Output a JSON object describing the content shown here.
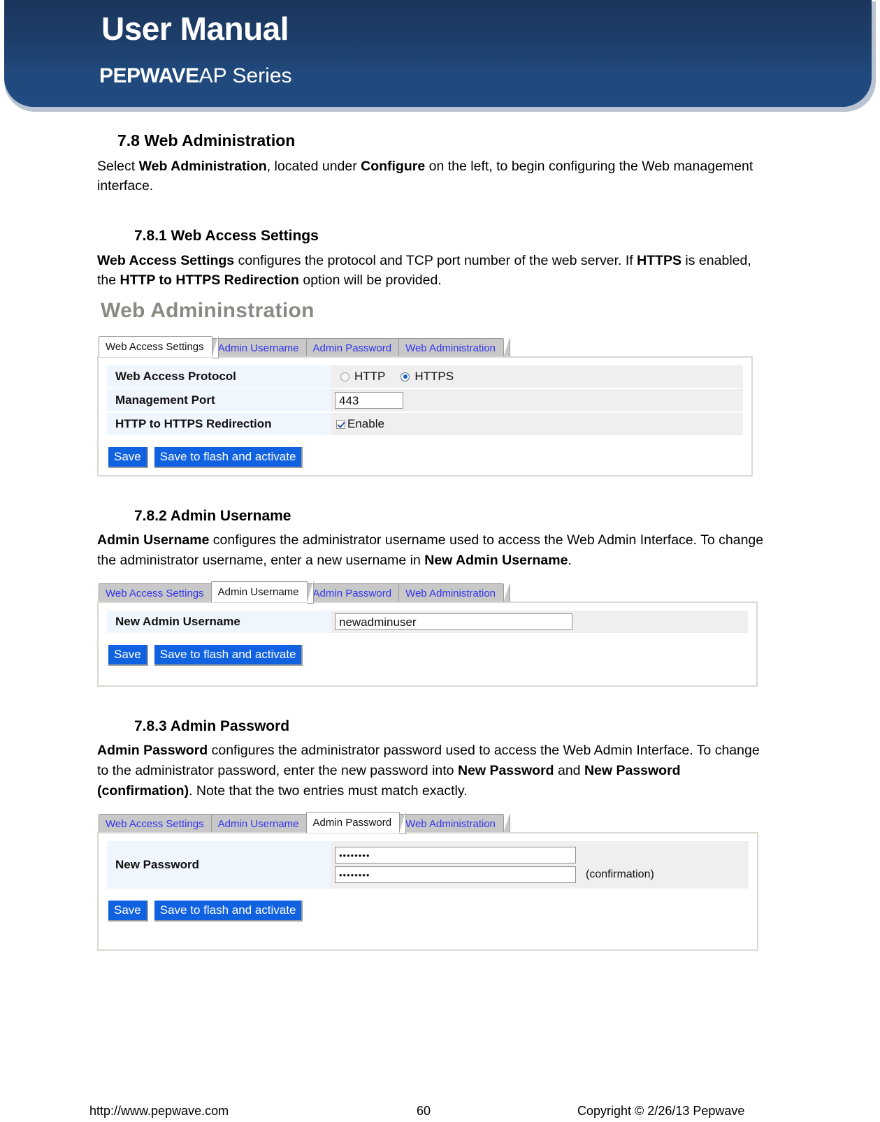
{
  "banner": {
    "title": "User Manual",
    "brand": "PEPWAVE",
    "series": "AP Series",
    "bg_color_top": "#1b365d",
    "bg_color_bottom": "#1f4b80"
  },
  "sections": {
    "s78": {
      "heading": "7.8 Web Administration",
      "para_1": "Select ",
      "para_1_b1": "Web Administration",
      "para_1_mid": ", located under ",
      "para_1_b2": "Configure",
      "para_1_end": " on the left, to begin configuring the Web management interface."
    },
    "s781": {
      "heading": "7.8.1 Web Access Settings",
      "para_b1": "Web Access Settings",
      "para_mid1": " configures the protocol and TCP port number of the web server. If ",
      "para_b2": "HTTPS",
      "para_mid2": " is enabled, the ",
      "para_b3": "HTTP to HTTPS Redirection",
      "para_end": " option will be provided."
    },
    "s782": {
      "heading": "7.8.2 Admin Username",
      "para_b1": "Admin Username",
      "para_mid1": " configures the administrator username used to access the Web Admin Interface. To change the administrator username, enter a new username in ",
      "para_b2": "New Admin Username",
      "para_end": "."
    },
    "s783": {
      "heading": "7.8.3 Admin Password",
      "para_b1": "Admin Password",
      "para_mid1": " configures the administrator password used to access the Web Admin Interface. To change to the administrator password, enter the new password into ",
      "para_b2": "New Password",
      "para_mid2": " and ",
      "para_b3": "New Password (confirmation)",
      "para_end": ". Note that the two entries must match exactly."
    }
  },
  "screenshot_1": {
    "title": "Web Admininstration",
    "tabs": [
      {
        "label": "Web Access Settings",
        "active": true
      },
      {
        "label": "Admin Username",
        "active": false
      },
      {
        "label": "Admin Password",
        "active": false
      },
      {
        "label": "Web Administration",
        "active": false
      }
    ],
    "rows": [
      {
        "label": "Web Access Protocol"
      },
      {
        "label": "Management Port"
      },
      {
        "label": "HTTP to HTTPS Redirection"
      }
    ],
    "protocol_options": [
      {
        "label": "HTTP",
        "selected": false
      },
      {
        "label": "HTTPS",
        "selected": true
      }
    ],
    "management_port": "443",
    "redirection_checkbox_label": "Enable",
    "redirection_checked": true,
    "buttons": [
      "Save",
      "Save to flash and activate"
    ]
  },
  "screenshot_2": {
    "tabs": [
      {
        "label": "Web Access Settings",
        "active": false
      },
      {
        "label": "Admin Username",
        "active": true
      },
      {
        "label": "Admin Password",
        "active": false
      },
      {
        "label": "Web Administration",
        "active": false
      }
    ],
    "row_label": "New Admin Username",
    "username_value": "newadminuser",
    "buttons": [
      "Save",
      "Save to flash and activate"
    ]
  },
  "screenshot_3": {
    "tabs": [
      {
        "label": "Web Access Settings",
        "active": false
      },
      {
        "label": "Admin Username",
        "active": false
      },
      {
        "label": "Admin Password",
        "active": true
      },
      {
        "label": "Web Administration",
        "active": false
      }
    ],
    "row_label": "New Password",
    "password_value": "••••••••",
    "password_confirm_value": "••••••••",
    "confirmation_label": "(confirmation)",
    "buttons": [
      "Save",
      "Save to flash and activate"
    ]
  },
  "footer": {
    "website": "http://www.pepwave.com",
    "page_number": "60",
    "copyright": "Copyright © 2/26/13 Pepwave"
  }
}
